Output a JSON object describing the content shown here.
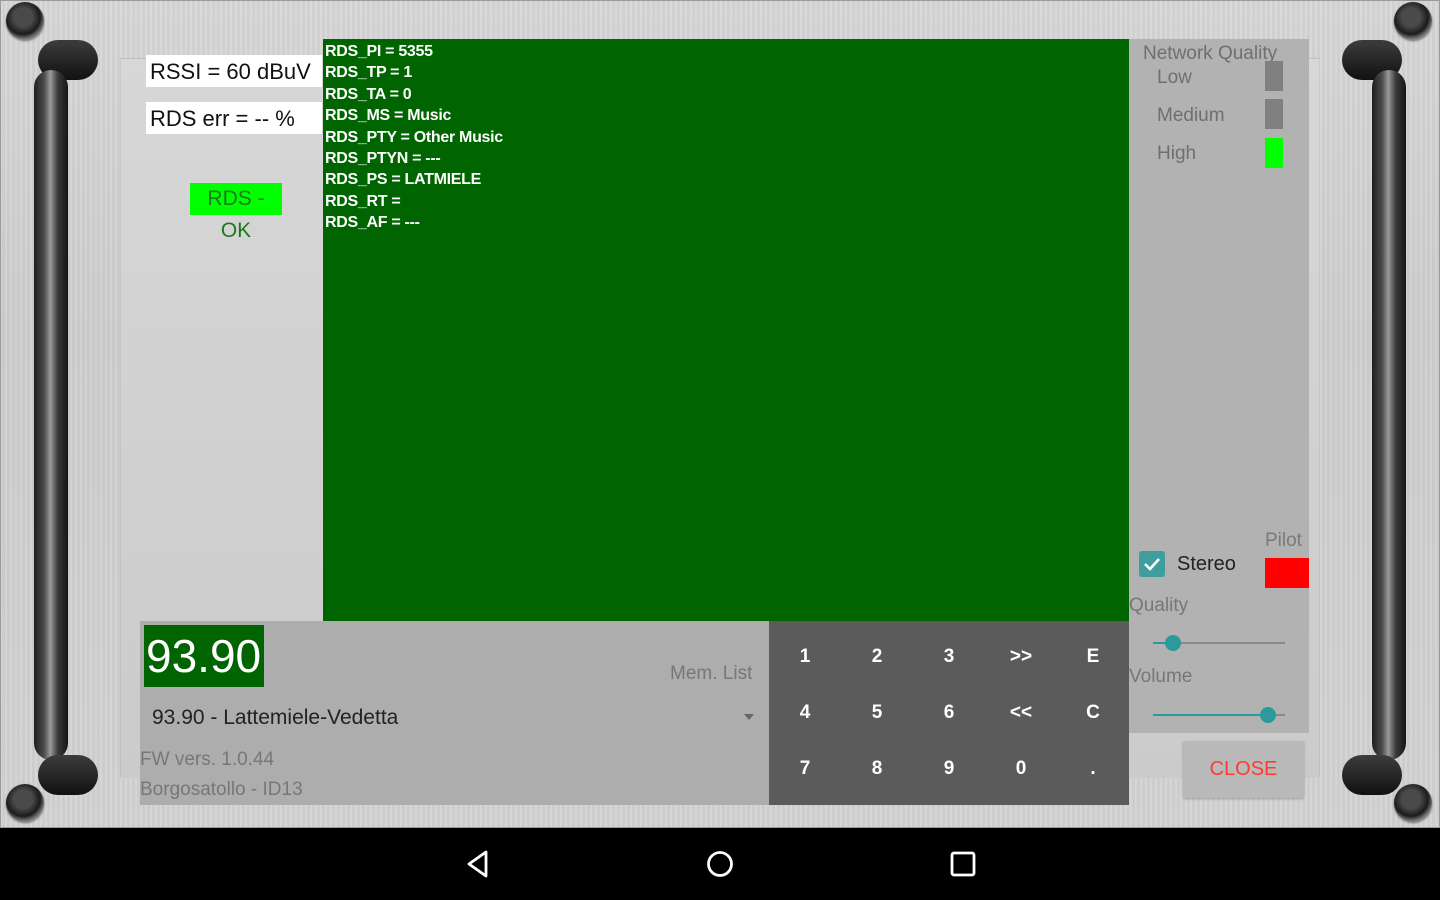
{
  "signal": {
    "rssi": "RSSI = 60 dBuV",
    "rds_err": "RDS err = -- %",
    "rds_status": "RDS - OK"
  },
  "rds_lines": [
    "RDS_PI = 5355",
    "RDS_TP = 1",
    "RDS_TA = 0",
    "RDS_MS = Music",
    "RDS_PTY = Other Music",
    "RDS_PTYN = ---",
    "RDS_PS = LATMIELE",
    "RDS_RT =",
    "RDS_AF = ---"
  ],
  "network": {
    "title": "Network Quality",
    "levels": [
      {
        "label": "Low",
        "active": false
      },
      {
        "label": "Medium",
        "active": false
      },
      {
        "label": "High",
        "active": true
      }
    ],
    "active_color": "#00ff00",
    "inactive_color": "#808080"
  },
  "audio": {
    "pilot_label": "Pilot",
    "pilot_color": "#ff0000",
    "stereo_label": "Stereo",
    "stereo_checked": true,
    "quality_label": "Quality",
    "quality_value": 0.15,
    "volume_label": "Volume",
    "volume_value": 0.87
  },
  "tuner": {
    "frequency": "93.90",
    "mem_label": "Mem. List",
    "selected_station": "93.90 - Lattemiele-Vedetta",
    "fw_version": "FW vers. 1.0.44",
    "location": "Borgosatollo - ID13"
  },
  "keypad": {
    "keys": [
      "1",
      "2",
      "3",
      ">>",
      "E",
      "4",
      "5",
      "6",
      "<<",
      "C",
      "7",
      "8",
      "9",
      "0",
      "."
    ]
  },
  "actions": {
    "close_label": "CLOSE"
  },
  "colors": {
    "console_bg": "#006400",
    "accent": "#2a9a9a",
    "close_text": "#ff3b30"
  },
  "navbar": {
    "icons": [
      "back-icon",
      "home-icon",
      "recents-icon"
    ]
  }
}
